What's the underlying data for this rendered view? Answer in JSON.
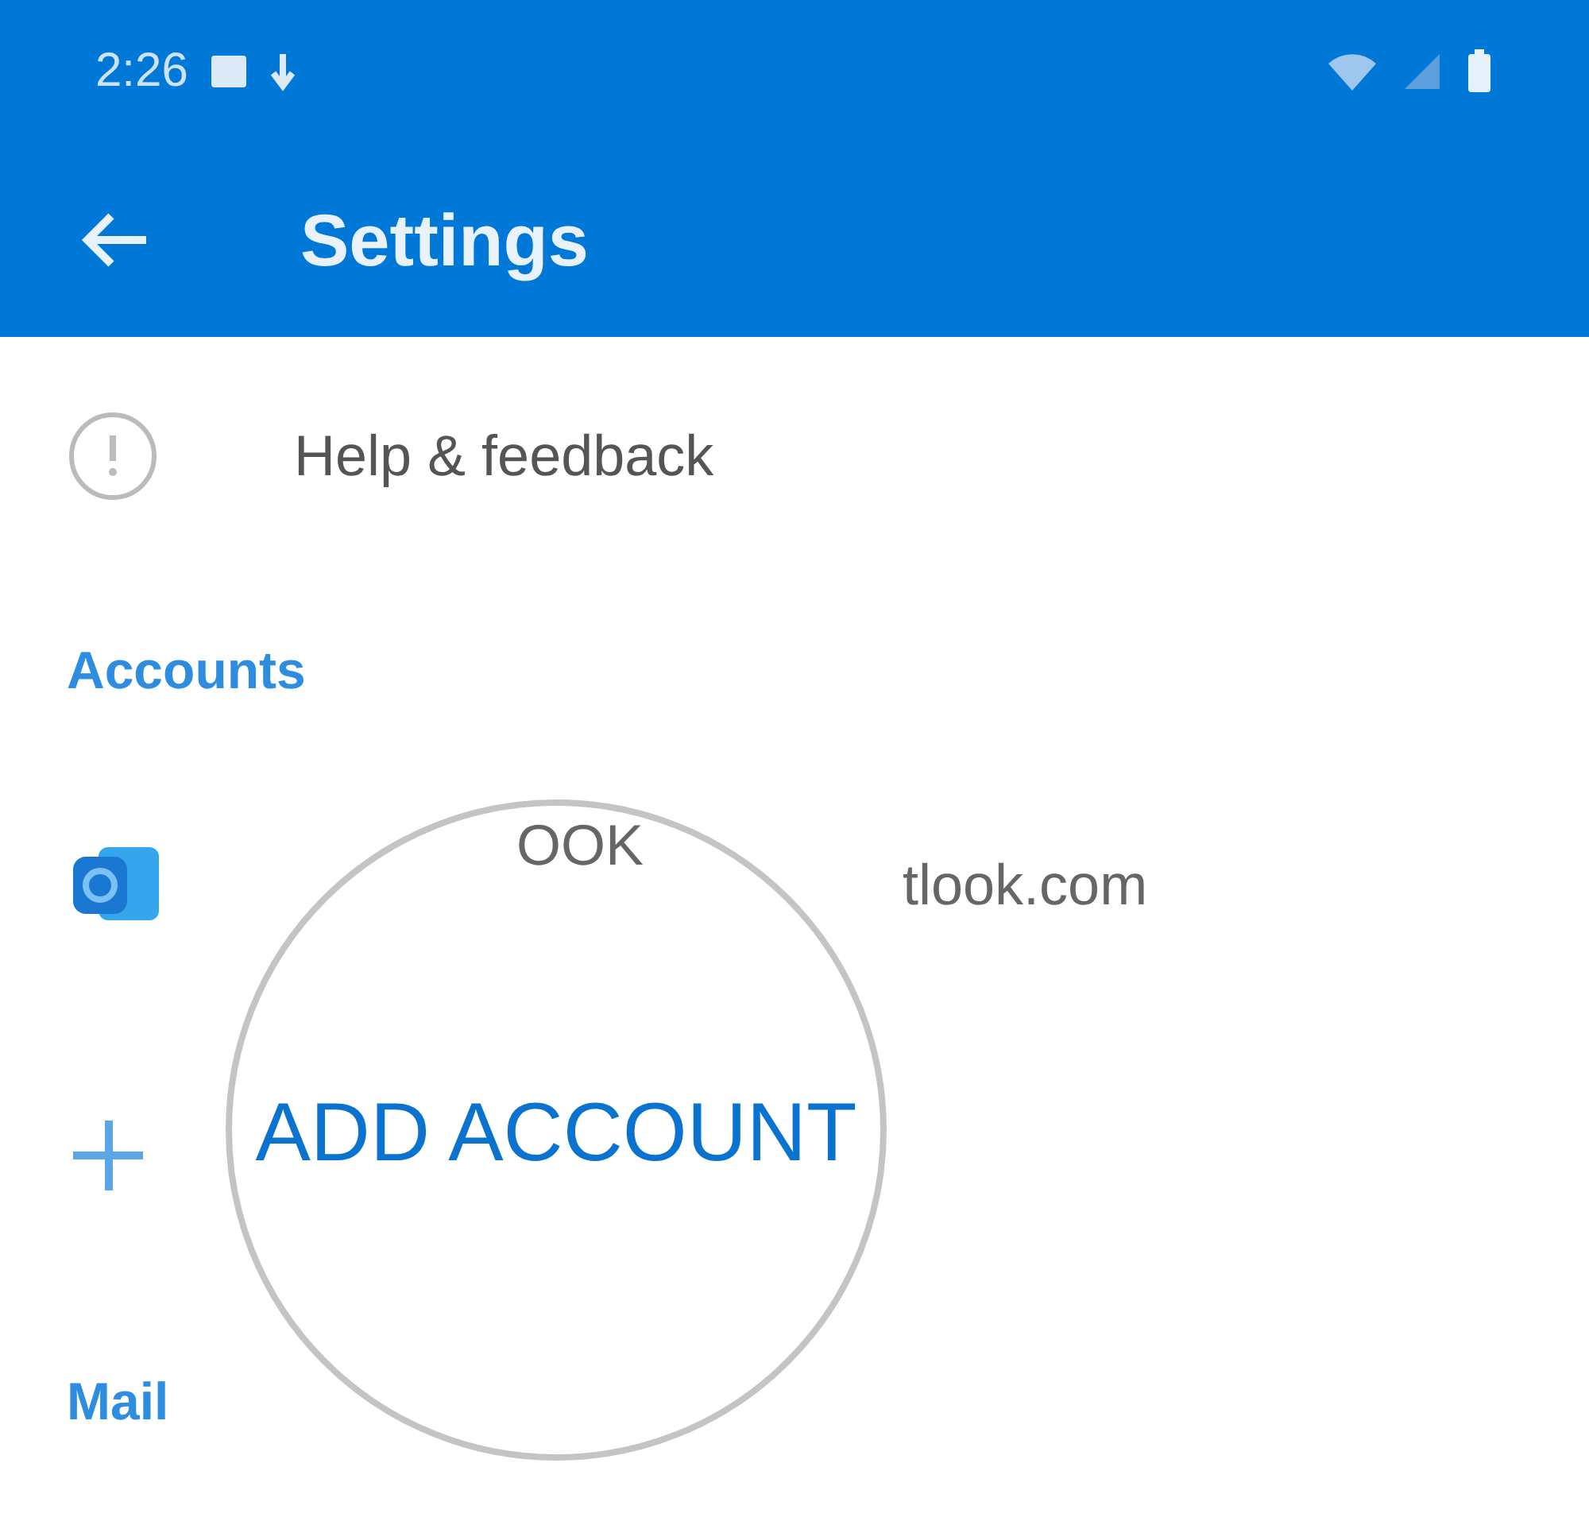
{
  "status_bar": {
    "time": "2:26"
  },
  "app_bar": {
    "title": "Settings"
  },
  "items": [
    {
      "kind": "row",
      "label": "Help & feedback"
    },
    {
      "kind": "header",
      "label": "Accounts"
    },
    {
      "kind": "account",
      "label": "tlook.com"
    },
    {
      "kind": "add"
    },
    {
      "kind": "header",
      "label": "Mail"
    }
  ],
  "magnifier": {
    "top_text": "OOK",
    "label": "ADD ACCOUNT"
  }
}
